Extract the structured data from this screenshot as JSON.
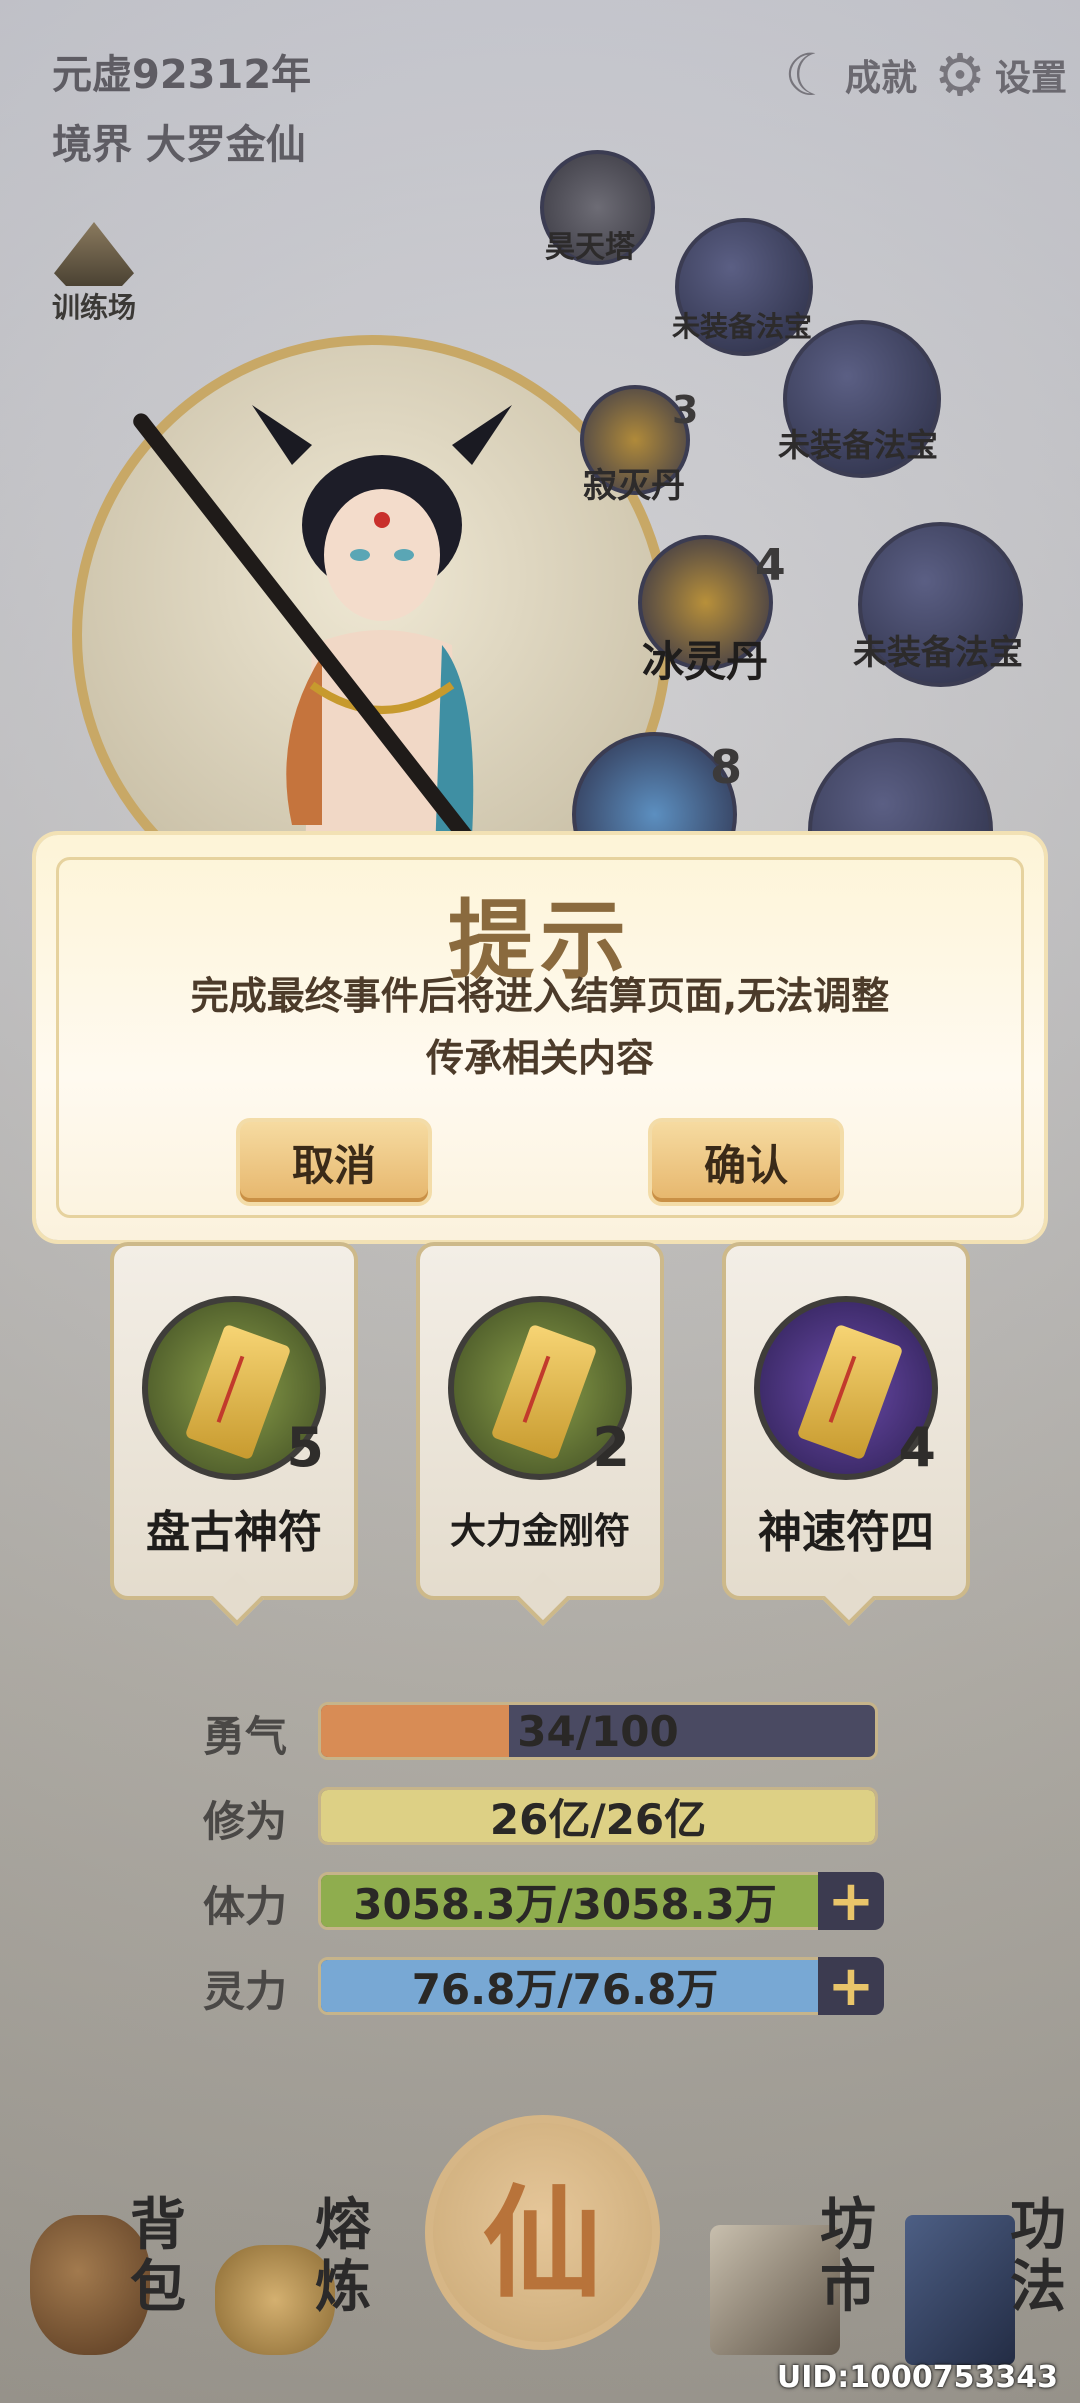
{
  "header": {
    "era": "元虚92312年",
    "realm": "境界 大罗金仙",
    "achievements_label": "成就",
    "settings_label": "设置"
  },
  "training": {
    "label": "训练场"
  },
  "artifacts": [
    {
      "label": "昊天塔",
      "count": ""
    },
    {
      "label": "未装备法宝",
      "count": ""
    },
    {
      "label": "寂灭丹",
      "count": "3"
    },
    {
      "label": "未装备法宝",
      "count": ""
    },
    {
      "label": "冰灵丹",
      "count": "4"
    },
    {
      "label": "未装备法宝",
      "count": ""
    },
    {
      "label": "",
      "count": "8"
    }
  ],
  "dialog": {
    "title": "提示",
    "message_line1": "完成最终事件后将进入结算页面,无法调整",
    "message_line2": "传承相关内容",
    "cancel_label": "取消",
    "confirm_label": "确认"
  },
  "talismans": [
    {
      "name": "盘古神符",
      "count": "5"
    },
    {
      "name": "大力金刚符",
      "count": "2"
    },
    {
      "name": "神速符四",
      "count": "4"
    }
  ],
  "stats": [
    {
      "label": "勇气",
      "value": "34/100",
      "fraction": 0.34,
      "color": "#d88c55",
      "plus": false
    },
    {
      "label": "修为",
      "value": "26亿/26亿",
      "fraction": 1.0,
      "color": "#ddd085",
      "plus": false
    },
    {
      "label": "体力",
      "value": "3058.3万/3058.3万",
      "fraction": 1.0,
      "color": "#8fad4e",
      "plus": true
    },
    {
      "label": "灵力",
      "value": "76.8万/76.8万",
      "fraction": 1.0,
      "color": "#78a8d4",
      "plus": true
    }
  ],
  "nav": {
    "bag": "背包",
    "refine": "熔炼",
    "center": "仙",
    "market": "坊市",
    "skills": "功法"
  },
  "uid": "UID:1000753343"
}
